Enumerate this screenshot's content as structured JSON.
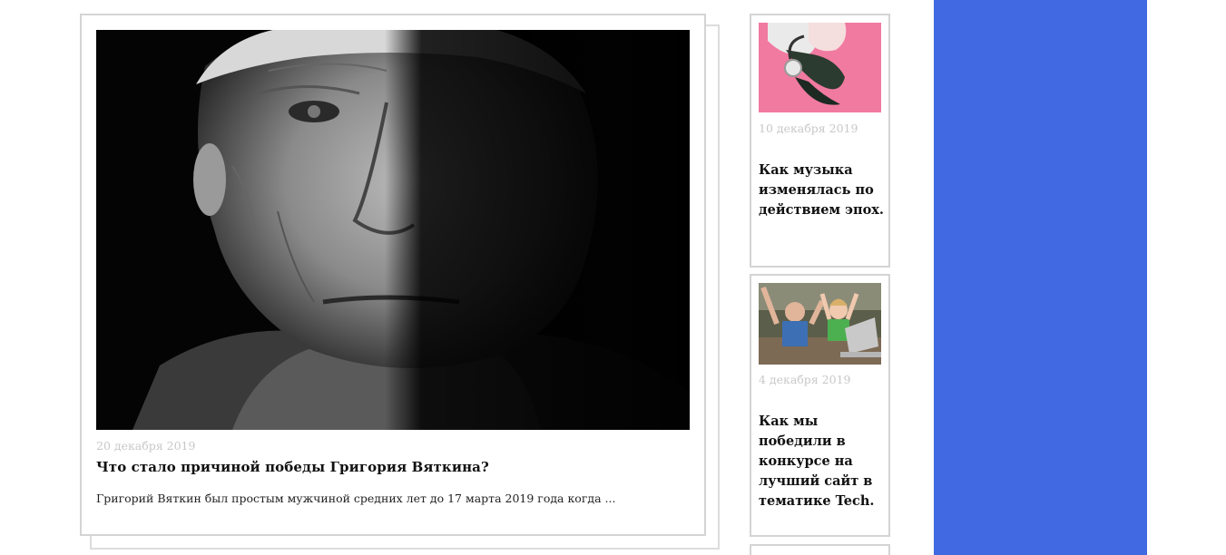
{
  "featured": {
    "image_alt": "Black and white portrait of an elderly man, half face in shadow",
    "date": "20 декабря 2019",
    "title": "Что стало причиной победы Григория Вяткина?",
    "excerpt": "Григорий Вяткин был простым мужчиной средних лет до 17 марта 2019 года когда ..."
  },
  "sidebar": {
    "posts": [
      {
        "date": "10 декабря 2019",
        "title": "Как музыка изменялась по действием эпох."
      },
      {
        "date": "4 декабря 2019",
        "title": "Как мы победили в конкурсе на лучший сайт в тематике Tech."
      }
    ]
  },
  "colors": {
    "accent_panel": "#4169e1",
    "card_border": "#d4d4d4",
    "date_text": "#c8c8c8"
  }
}
